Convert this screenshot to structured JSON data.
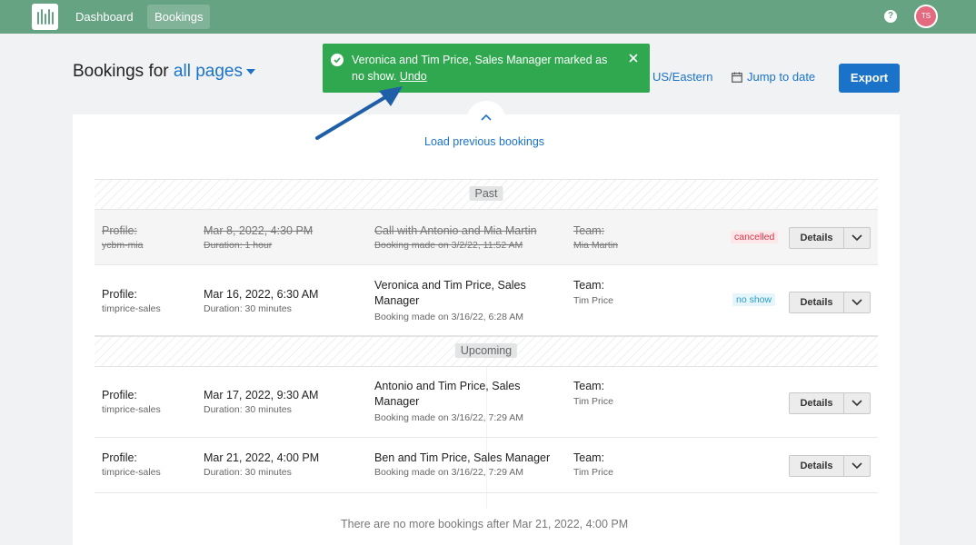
{
  "nav": {
    "logo_icon": "calendar-bars-logo",
    "dashboard": "Dashboard",
    "bookings": "Bookings",
    "help": "?",
    "avatar_initials": "TS"
  },
  "header": {
    "title_prefix": "Bookings for",
    "filter": "all pages",
    "timezone": "US/Eastern",
    "jump": "Jump to date",
    "export": "Export"
  },
  "toast": {
    "message": "Veronica and Tim Price, Sales Manager marked as no show.",
    "undo": "Undo"
  },
  "list": {
    "load_previous": "Load previous bookings",
    "past_label": "Past",
    "upcoming_label": "Upcoming",
    "footer": "There are no more bookings after Mar 21, 2022, 4:00 PM"
  },
  "bookings": [
    {
      "profile_label": "Profile:",
      "profile": "ycbm-mia",
      "datetime": "Mar 8, 2022, 4:30 PM",
      "duration": "Duration: 1 hour",
      "title": "Call with Antonio and Mia Martin",
      "booked": "Booking made on 3/2/22, 11:52 AM",
      "team_label": "Team:",
      "team": "Mia Martin",
      "status": "cancelled",
      "details": "Details"
    },
    {
      "profile_label": "Profile:",
      "profile": "timprice-sales",
      "datetime": "Mar 16, 2022, 6:30 AM",
      "duration": "Duration: 30 minutes",
      "title": "Veronica and Tim Price, Sales Manager",
      "booked": "Booking made on 3/16/22, 6:28 AM",
      "team_label": "Team:",
      "team": "Tim Price",
      "status": "no show",
      "details": "Details"
    },
    {
      "profile_label": "Profile:",
      "profile": "timprice-sales",
      "datetime": "Mar 17, 2022, 9:30 AM",
      "duration": "Duration: 30 minutes",
      "title": "Antonio and Tim Price, Sales Manager",
      "booked": "Booking made on 3/16/22, 7:29 AM",
      "team_label": "Team:",
      "team": "Tim Price",
      "status": "",
      "details": "Details"
    },
    {
      "profile_label": "Profile:",
      "profile": "timprice-sales",
      "datetime": "Mar 21, 2022, 4:00 PM",
      "duration": "Duration: 30 minutes",
      "title": "Ben and Tim Price, Sales Manager",
      "booked": "Booking made on 3/16/22, 7:29 AM",
      "team_label": "Team:",
      "team": "Tim Price",
      "status": "",
      "details": "Details"
    }
  ],
  "colors": {
    "nav_bg": "#66a383",
    "accent": "#1a73c8",
    "toast_bg": "#2fa84f",
    "cancelled": "#d6344a",
    "no_show": "#2b9cc7"
  }
}
